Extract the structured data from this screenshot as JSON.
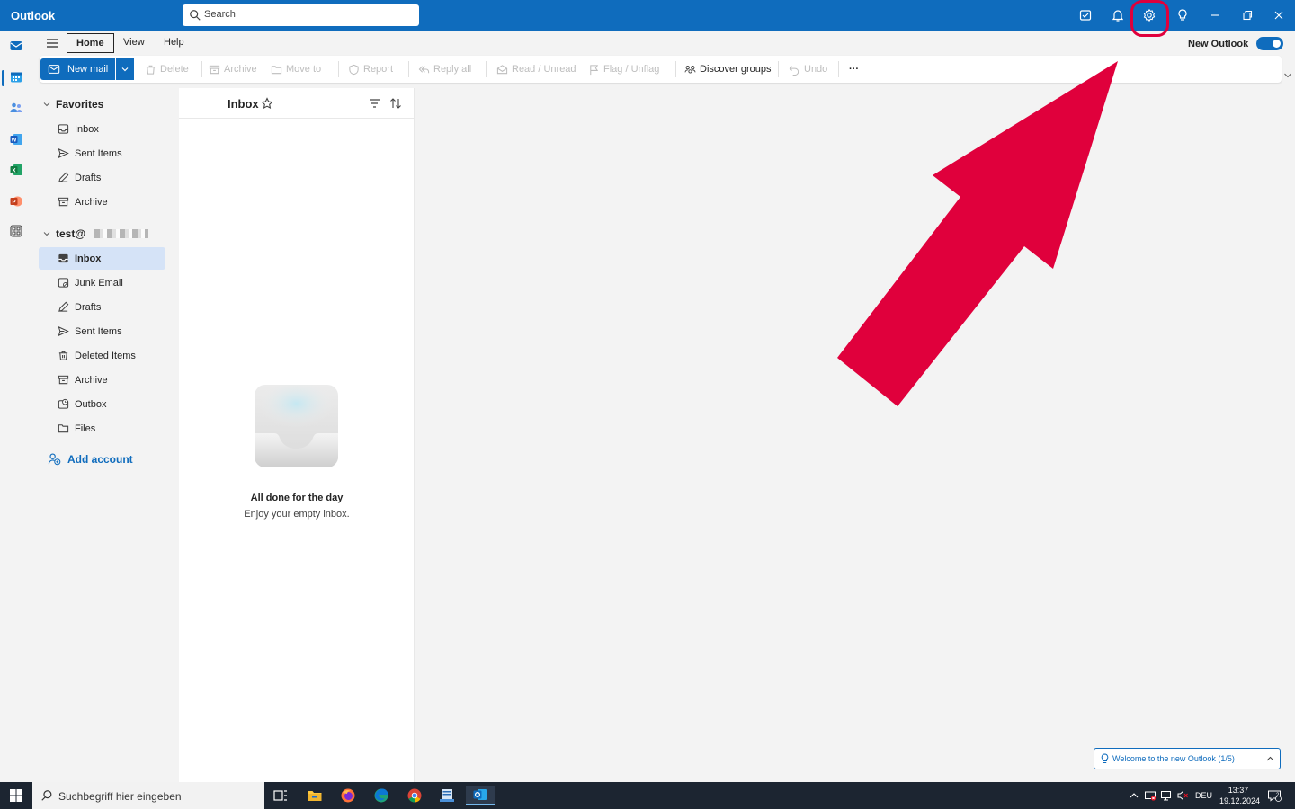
{
  "titlebar": {
    "app_title": "Outlook",
    "search_placeholder": "Search"
  },
  "menu": {
    "tabs": [
      {
        "label": "Home",
        "active": true
      },
      {
        "label": "View",
        "active": false
      },
      {
        "label": "Help",
        "active": false
      }
    ],
    "new_outlook_label": "New Outlook",
    "new_outlook_toggle_on": true
  },
  "ribbon": {
    "new_mail": "New mail",
    "delete": "Delete",
    "archive": "Archive",
    "move_to": "Move to",
    "report": "Report",
    "reply_all": "Reply all",
    "read_unread": "Read / Unread",
    "flag_unflag": "Flag / Unflag",
    "discover_groups": "Discover groups",
    "undo": "Undo",
    "more": "···"
  },
  "folders": {
    "favorites_label": "Favorites",
    "favorites": [
      "Inbox",
      "Sent Items",
      "Drafts",
      "Archive"
    ],
    "account_label": "test@",
    "account_folders": [
      "Inbox",
      "Junk Email",
      "Drafts",
      "Sent Items",
      "Deleted Items",
      "Archive",
      "Outbox",
      "Files"
    ],
    "selected": "Inbox",
    "add_account": "Add account"
  },
  "message_list": {
    "title": "Inbox",
    "empty_title": "All done for the day",
    "empty_subtitle": "Enjoy your empty inbox."
  },
  "welcome": {
    "label": "Welcome to the new Outlook  (1/5)"
  },
  "taskbar": {
    "search_placeholder": "Suchbegriff hier eingeben",
    "language": "DEU",
    "time": "13:37",
    "date": "19.12.2024",
    "notifications_count": "2"
  },
  "colors": {
    "brand": "#0f6cbd",
    "highlight_annotation": "#e0003c",
    "selected_folder_bg": "#d5e3f7"
  }
}
